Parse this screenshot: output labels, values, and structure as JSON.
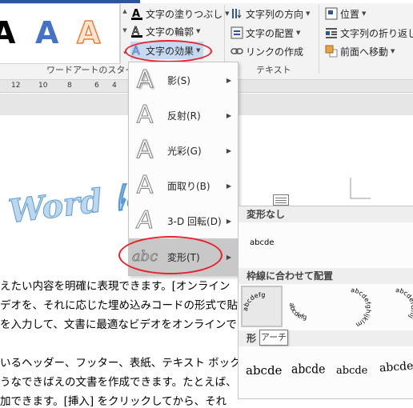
{
  "ribbon": {
    "wordart_group_label": "ワードアートのスタイル",
    "text_group_label": "テキスト",
    "commands": {
      "text_fill": "文字の塗りつぶし",
      "text_outline": "文字の輪郭",
      "text_effects": "文字の効果",
      "text_direction": "文字列の方向",
      "align_text": "文字の配置",
      "create_link": "リンクの作成",
      "position": "位置",
      "wrap_text": "文字列の折り返し",
      "bring_forward": "前面へ移動"
    },
    "gallery": [
      "A",
      "A",
      "A"
    ]
  },
  "ruler": {
    "numbers": [
      "12",
      "10",
      "8",
      "6",
      "4",
      "2"
    ]
  },
  "document": {
    "wordart_text": "Word に",
    "lines": [
      "えたい内容を明確に表現できます。[オンライン",
      "デオを、それに応じた埋め込みコードの形式で貼",
      "を入力して、文書に最適なビデオをオンラインで",
      "いるヘッダー、フッター、表紙、テキスト ボック",
      "うなできばえの文書を作成できます。たとえば、",
      "加できます。[挿入] をクリックしてから、それ"
    ]
  },
  "effects_menu": {
    "items": [
      {
        "label": "影(S)",
        "icon": "shadow-icon"
      },
      {
        "label": "反射(R)",
        "icon": "reflection-icon"
      },
      {
        "label": "光彩(G)",
        "icon": "glow-icon"
      },
      {
        "label": "面取り(B)",
        "icon": "bevel-icon"
      },
      {
        "label": "3-D 回転(D)",
        "icon": "3d-rotation-icon"
      },
      {
        "label": "変形(T)",
        "icon": "transform-icon"
      }
    ],
    "transform_icon_text": "abc"
  },
  "transform_submenu": {
    "no_transform_header": "変形なし",
    "no_transform_sample": "abcde",
    "follow_path_header": "枠線に合わせて配置",
    "arch_sample": "abcdefg",
    "arch_down_sample": "abcdefg",
    "circle_sample": "abcdefghijklm",
    "button_sample": "abcdefGhij",
    "warp_header": "形",
    "warp_samples": [
      "abcde",
      "abcde",
      "abcde",
      "abcde"
    ]
  },
  "tooltip": {
    "text": "アーチ"
  },
  "colors": {
    "accent_blue": "#2b579a",
    "highlight_red": "#e8202a",
    "wordart_blue": "#4472c4",
    "wordart_orange": "#ed7d31"
  }
}
